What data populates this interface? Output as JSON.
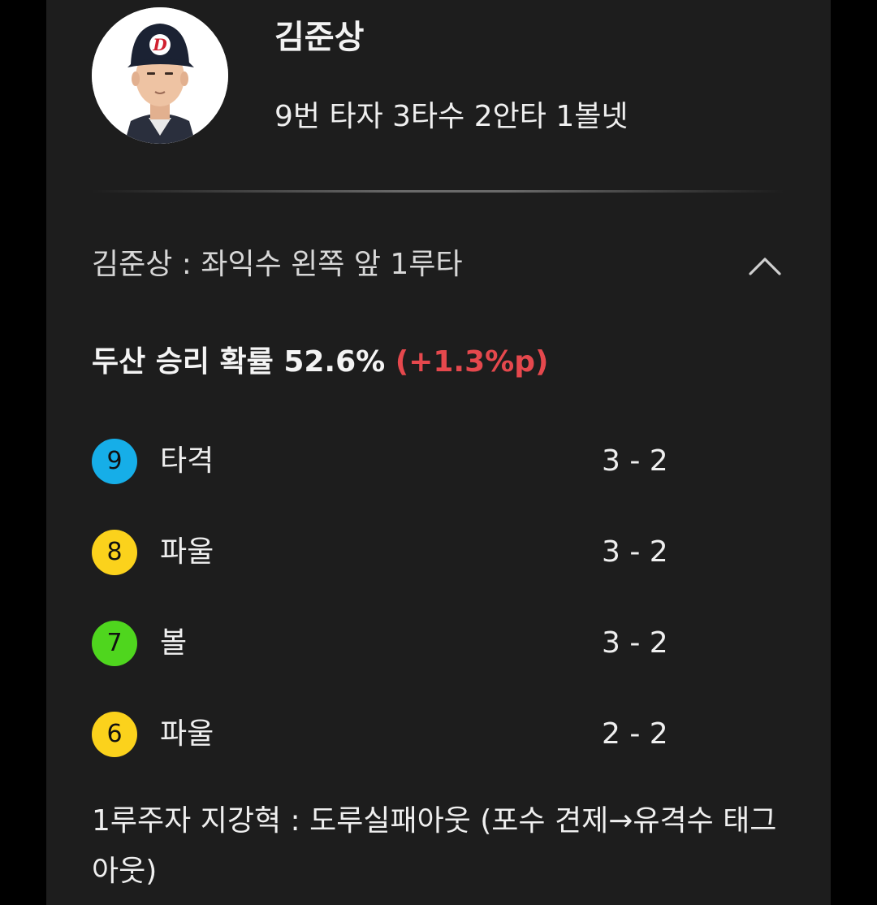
{
  "player": {
    "name": "김준상",
    "stats": "9번 타자  3타수 2안타 1볼넷",
    "avatar_icon": "player-photo"
  },
  "play": {
    "title": "김준상 : 좌익수 왼쪽 앞 1루타",
    "toggle_icon": "chevron-up-icon"
  },
  "win_probability": {
    "text": "두산 승리 확률 52.6% ",
    "delta": "(+1.3%p)",
    "delta_color": "#e5484d"
  },
  "pitches": [
    {
      "number": "9",
      "result": "타격",
      "count": "3 - 2",
      "color": "#16aee8"
    },
    {
      "number": "8",
      "result": "파울",
      "count": "3 - 2",
      "color": "#fbd21c"
    },
    {
      "number": "7",
      "result": "볼",
      "count": "3 - 2",
      "color": "#4fd61e"
    },
    {
      "number": "6",
      "result": "파울",
      "count": "2 - 2",
      "color": "#fbd21c"
    }
  ],
  "footnote": "1루주자 지강혁 : 도루실패아웃 (포수 견제→유격수 태그아웃)"
}
